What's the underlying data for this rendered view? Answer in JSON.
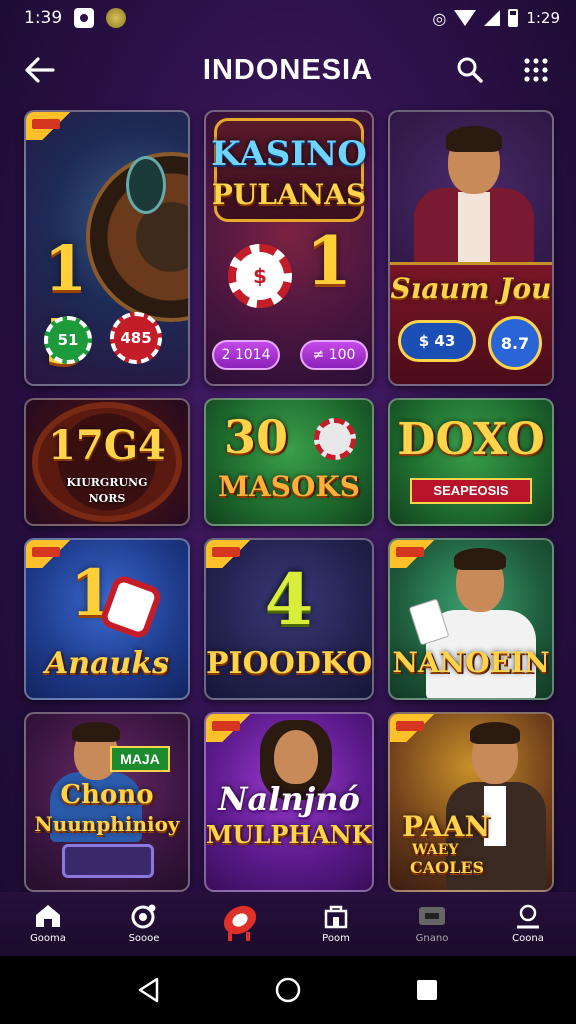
{
  "status_bar": {
    "time": "1:39",
    "battery_text": "1:29"
  },
  "header": {
    "title": "INDONESIA"
  },
  "tiles": [
    {
      "title": "",
      "big": "1 5",
      "chip_a": "51",
      "chip_b": "485"
    },
    {
      "title": "KASINO",
      "subtitle": "PULANAS",
      "big": "1",
      "pill_a": "2 1014",
      "pill_b": "≠ 100"
    },
    {
      "title": "Sıaum Jou",
      "chip_a": "$ 43",
      "chip_b": "8.7"
    },
    {
      "title": "17G4",
      "subtitle": "KIURGRUNG",
      "subtitle2": "NORS"
    },
    {
      "title": "30",
      "subtitle": "MASOKS"
    },
    {
      "title": "DOXO",
      "subtitle": "SEAPEOSIS"
    },
    {
      "title": "1",
      "subtitle": "Anauks"
    },
    {
      "title": "4",
      "subtitle": "PIOODKO"
    },
    {
      "title": "NANOEIN"
    },
    {
      "title": "Chono",
      "subtitle": "Nuunphinioy",
      "badge_text": "MAJA"
    },
    {
      "title": "Nalnjnó",
      "subtitle": "MULPHANK"
    },
    {
      "title": "PAAN",
      "subtitle": "WAEY",
      "subtitle2": "CAOLES"
    }
  ],
  "bottom_nav": [
    {
      "label": "Gooma",
      "icon": "home-icon"
    },
    {
      "label": "Soooe",
      "icon": "chip-icon"
    },
    {
      "label": "",
      "icon": "roulette-icon"
    },
    {
      "label": "Poom",
      "icon": "shop-icon"
    },
    {
      "label": "Gnano",
      "icon": "wallet-icon"
    },
    {
      "label": "Coona",
      "icon": "profile-icon"
    }
  ],
  "colors": {
    "gold": "#ffcf3a",
    "purple_bg": "#2a1046",
    "accent_purple": "#c34ae6"
  }
}
